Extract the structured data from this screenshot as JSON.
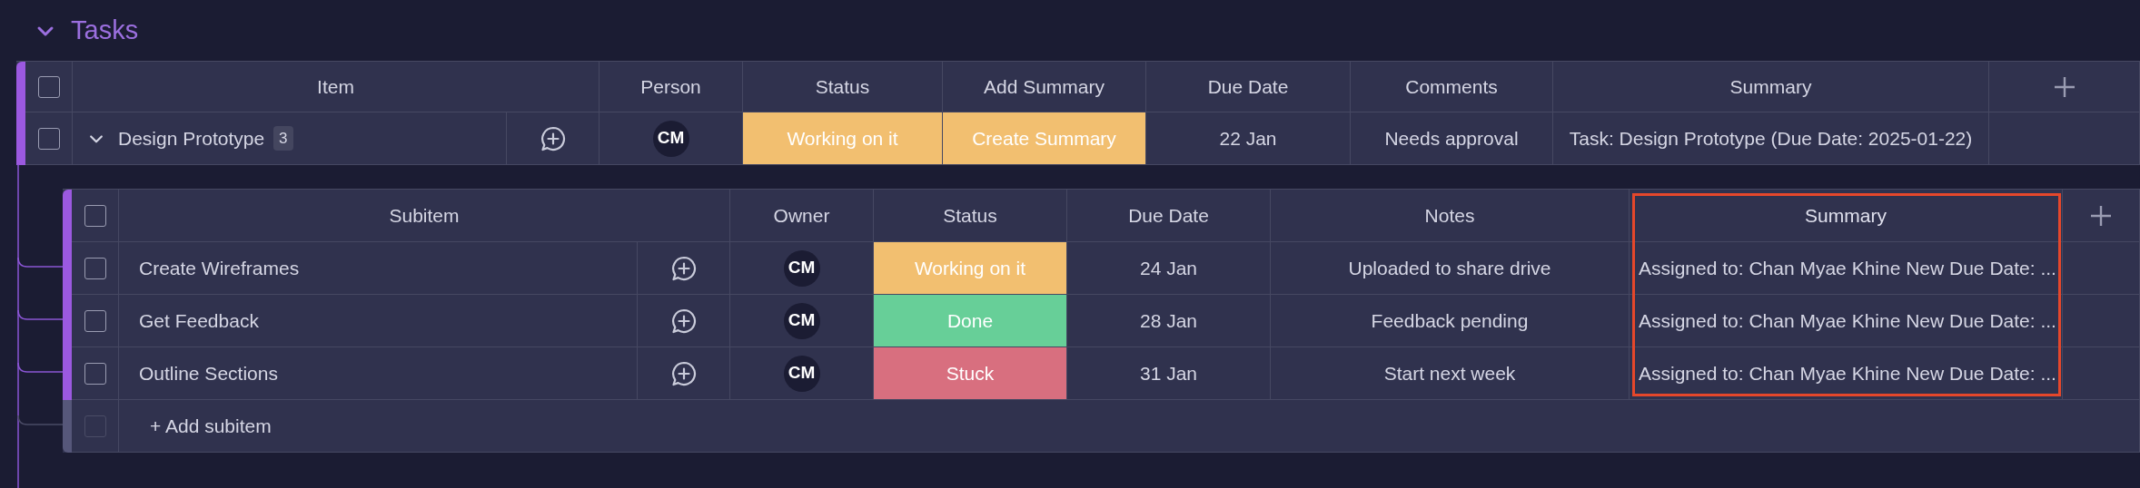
{
  "group": {
    "title": "Tasks",
    "expanded": true
  },
  "table": {
    "select_all_checked": false,
    "columns": [
      {
        "label": "Item"
      },
      {
        "label": "Person"
      },
      {
        "label": "Status"
      },
      {
        "label": "Add Summary"
      },
      {
        "label": "Due Date"
      },
      {
        "label": "Comments"
      },
      {
        "label": "Summary"
      }
    ],
    "rows": [
      {
        "checked": false,
        "expanded": true,
        "item": "Design Prototype",
        "subitem_count": "3",
        "person": "CM",
        "status": {
          "label": "Working on it",
          "color": "#f2bf70"
        },
        "add_summary": {
          "label": "Create Summary",
          "color": "#f2bf70"
        },
        "due_date": "22 Jan",
        "comments": "Needs approval",
        "summary": "Task: Design Prototype (Due Date: 2025-01-22)"
      }
    ]
  },
  "subitems": {
    "select_all_checked": false,
    "columns": [
      {
        "label": "Subitem",
        "highlighted": false
      },
      {
        "label": "Owner",
        "highlighted": false
      },
      {
        "label": "Status",
        "highlighted": false
      },
      {
        "label": "Due Date",
        "highlighted": false
      },
      {
        "label": "Notes",
        "highlighted": false
      },
      {
        "label": "Summary",
        "highlighted": true
      }
    ],
    "rows": [
      {
        "checked": false,
        "name": "Create Wireframes",
        "owner": "CM",
        "status": {
          "label": "Working on it",
          "color": "#f2bf70"
        },
        "due_date": "24 Jan",
        "notes": "Uploaded to share drive",
        "summary": "Assigned to: Chan Myae Khine New Due Date: ..."
      },
      {
        "checked": false,
        "name": "Get Feedback",
        "owner": "CM",
        "status": {
          "label": "Done",
          "color": "#67cf98"
        },
        "due_date": "28 Jan",
        "notes": "Feedback pending",
        "summary": "Assigned to: Chan Myae Khine New Due Date: ..."
      },
      {
        "checked": false,
        "name": "Outline Sections",
        "owner": "CM",
        "status": {
          "label": "Stuck",
          "color": "#d86f7f"
        },
        "due_date": "31 Jan",
        "notes": "Start next week",
        "summary": "Assigned to: Chan Myae Khine New Due Date: ..."
      }
    ],
    "add_row": "+ Add subitem",
    "add_row_disabled": true
  }
}
